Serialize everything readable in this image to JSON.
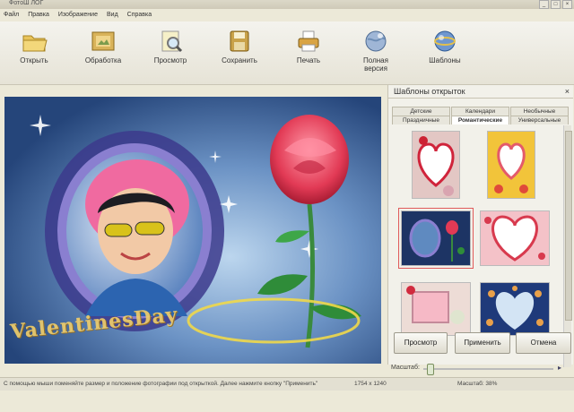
{
  "window": {
    "title": "ФотоШ ЛОГ"
  },
  "menu": [
    "Файл",
    "Правка",
    "Изображение",
    "Вид",
    "Справка"
  ],
  "toolbar": {
    "items": [
      {
        "label": "Открыть",
        "icon": "folder-open-icon"
      },
      {
        "label": "Обработка",
        "icon": "image-edit-icon"
      },
      {
        "label": "Просмотр",
        "icon": "preview-icon"
      },
      {
        "label": "Сохранить",
        "icon": "save-icon"
      },
      {
        "label": "Печать",
        "icon": "printer-icon"
      },
      {
        "label": "Полная версия",
        "icon": "globe-icon"
      },
      {
        "label": "Шаблоны",
        "icon": "templates-globe-icon"
      }
    ]
  },
  "canvas": {
    "watermark_text": "ValentinesDay"
  },
  "panel": {
    "title": "Шаблоны открыток",
    "tabs_row1": [
      "Детские",
      "Календари",
      "Необычные"
    ],
    "tabs_row2": [
      "Праздничные",
      "Романтические",
      "Универсальные"
    ],
    "active_tab": "Романтические",
    "buttons": {
      "preview": "Просмотр",
      "apply": "Применить",
      "cancel": "Отмена"
    },
    "zoom_label": "Масштаб:"
  },
  "status": {
    "hint": "С помощью мыши поменяйте размер и положение фотографии под открыткой. Далее нажмите кнопку \"Применить\"",
    "dimensions": "1754 x 1240",
    "zoom": "Масштаб: 38%"
  },
  "colors": {
    "accent": "#e05a5a",
    "panel_bg": "#f2f1ea",
    "canvas_dark": "#25457a"
  }
}
